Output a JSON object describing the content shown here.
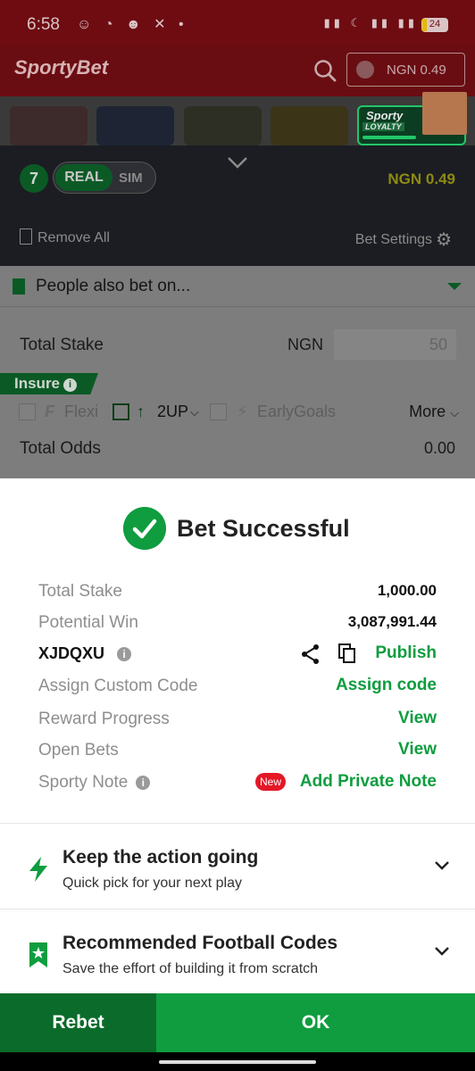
{
  "status_bar": {
    "time": "6:58",
    "battery": "24"
  },
  "header": {
    "logo": "SportyBet",
    "balance": "NGN 0.49"
  },
  "banner": {
    "loyalty_line1": "Sporty",
    "loyalty_line2": "LOYALTY"
  },
  "betslip": {
    "count": "7",
    "mode_real": "REAL",
    "mode_sim": "SIM",
    "balance": "NGN 0.49",
    "remove_all": "Remove All",
    "bet_settings": "Bet Settings",
    "people_also_bet": "People also bet on...",
    "total_stake_label": "Total Stake",
    "currency": "NGN",
    "stake_value": "50",
    "insure": "Insure",
    "options": [
      "Flexi",
      "2UP",
      "EarlyGoals"
    ],
    "more": "More",
    "total_odds_label": "Total Odds",
    "total_odds_value": "0.00"
  },
  "success": {
    "title": "Bet Successful",
    "rows": {
      "total_stake_label": "Total Stake",
      "total_stake_value": "1,000.00",
      "potential_win_label": "Potential Win",
      "potential_win_value": "3,087,991.44",
      "booking_code": "XJDQXU",
      "publish": "Publish",
      "assign_label": "Assign Custom Code",
      "assign_action": "Assign code",
      "reward_label": "Reward Progress",
      "reward_action": "View",
      "open_bets_label": "Open Bets",
      "open_bets_action": "View",
      "note_label": "Sporty Note",
      "new_badge": "New",
      "note_action": "Add Private Note"
    }
  },
  "sections": [
    {
      "title": "Keep the action going",
      "subtitle": "Quick pick for your next play"
    },
    {
      "title": "Recommended Football Codes",
      "subtitle": "Save the effort of building it from scratch"
    }
  ],
  "buttons": {
    "rebet": "Rebet",
    "ok": "OK"
  },
  "colors": {
    "brand_green": "#0f9d3f",
    "dark_green": "#0b6b2a",
    "alert_red": "#e41827"
  }
}
